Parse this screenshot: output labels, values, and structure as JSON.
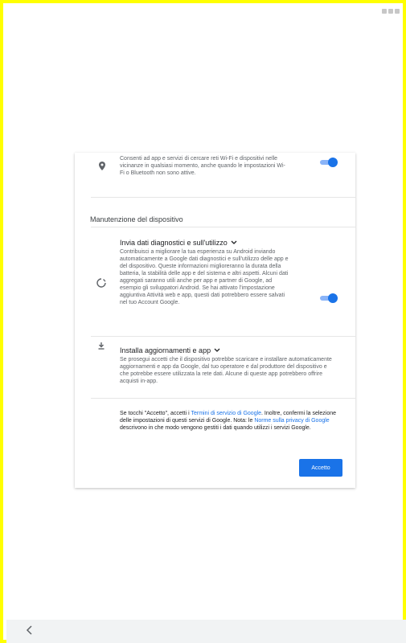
{
  "status_bar": {
    "icons": [
      "wifi-icon",
      "signal-icon",
      "battery-icon"
    ]
  },
  "location_row": {
    "icon": "location-pin-icon",
    "description": "Consenti ad app e servizi di cercare reti Wi-Fi e dispositivi nelle vicinanze in qualsiasi momento, anche quando le impostazioni Wi-Fi o Bluetooth non sono attive.",
    "toggle_on": true
  },
  "section": {
    "title": "Manutenzione del dispositivo"
  },
  "diagnostics_row": {
    "icon": "diagnostics-ring-icon",
    "title": "Invia dati diagnostici e sull'utilizzo",
    "description": "Contribuisci a migliorare la tua esperienza su Android inviando automaticamente a Google dati diagnostici e sull'utilizzo delle app e del dispositivo. Queste informazioni miglioreranno la durata della batteria, la stabilità delle app e del sistema e altri aspetti. Alcuni dati aggregati saranno utili anche per app e partner di Google, ad esempio gli sviluppatori Android. Se hai attivato l'impostazione aggiuntiva Attività web e app, questi dati potrebbero essere salvati nel tuo Account Google.",
    "toggle_on": true
  },
  "updates_row": {
    "icon": "download-icon",
    "title": "Installa aggiornamenti e app",
    "description": "Se prosegui accetti che il dispositivo potrebbe scaricare e installare automaticamente aggiornamenti e app da Google, dal tuo operatore e dal produttore del dispositivo e che potrebbe essere utilizzata la rete dati. Alcune di queste app potrebbero offrire acquisti in-app."
  },
  "consent": {
    "part1": "Se tocchi \"Accetto\", accetti i ",
    "terms_link": "Termini di servizio di Google",
    "part2": ". Inoltre, confermi la selezione delle impostazioni di questi servizi di Google. Nota: le ",
    "privacy_link": "Norme sulla privacy di Google",
    "part3": " descrivono in che modo vengono gestiti i dati quando utilizzi i servizi Google."
  },
  "accept_button": {
    "label": "Accetto",
    "color": "#1a73e8"
  },
  "nav": {
    "back_icon": "back-chevron-icon"
  },
  "colors": {
    "frame_border": "#ffff00",
    "accent": "#1a73e8",
    "toggle_track": "#8ab4f8"
  }
}
